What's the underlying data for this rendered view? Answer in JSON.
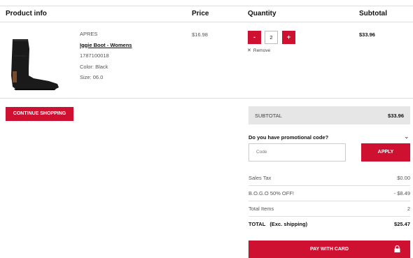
{
  "table_header": {
    "product_info": "Product info",
    "price": "Price",
    "quantity": "Quantity",
    "subtotal": "Subtotal"
  },
  "product": {
    "brand": "APRES",
    "name": "Iggie Boot - Womens",
    "sku": "1787100018",
    "color": "Color: Black",
    "size": "Size: 06.0",
    "price": "$16.98",
    "quantity": "2",
    "minus_label": "-",
    "plus_label": "+",
    "remove_label": "Remove",
    "line_subtotal": "$33.96"
  },
  "continue_label": "CONTINUE SHOPPING",
  "summary": {
    "subtotal_label": "SUBTOTAL",
    "subtotal_value": "$33.96",
    "promo_question": "Do you have promotional code?",
    "code_placeholder": "Code",
    "apply_label": "APPLY",
    "rows": [
      {
        "label": "Sales Tax",
        "value": "$0.00"
      },
      {
        "label": "B.O.G.O 50% OFF!",
        "value": "- $8.49"
      },
      {
        "label": "Total Items",
        "value": "2"
      }
    ],
    "total_label": "TOTAL",
    "total_note": "(Exc. shipping)",
    "total_value": "$25.47",
    "pay_label": "PAY WITH CARD"
  },
  "colors": {
    "accent": "#cf1131",
    "summary_bg": "#e6e6e6"
  },
  "icons": {
    "remove": "close-icon",
    "promo_toggle": "chevron-down-icon",
    "pay": "lock-icon"
  }
}
